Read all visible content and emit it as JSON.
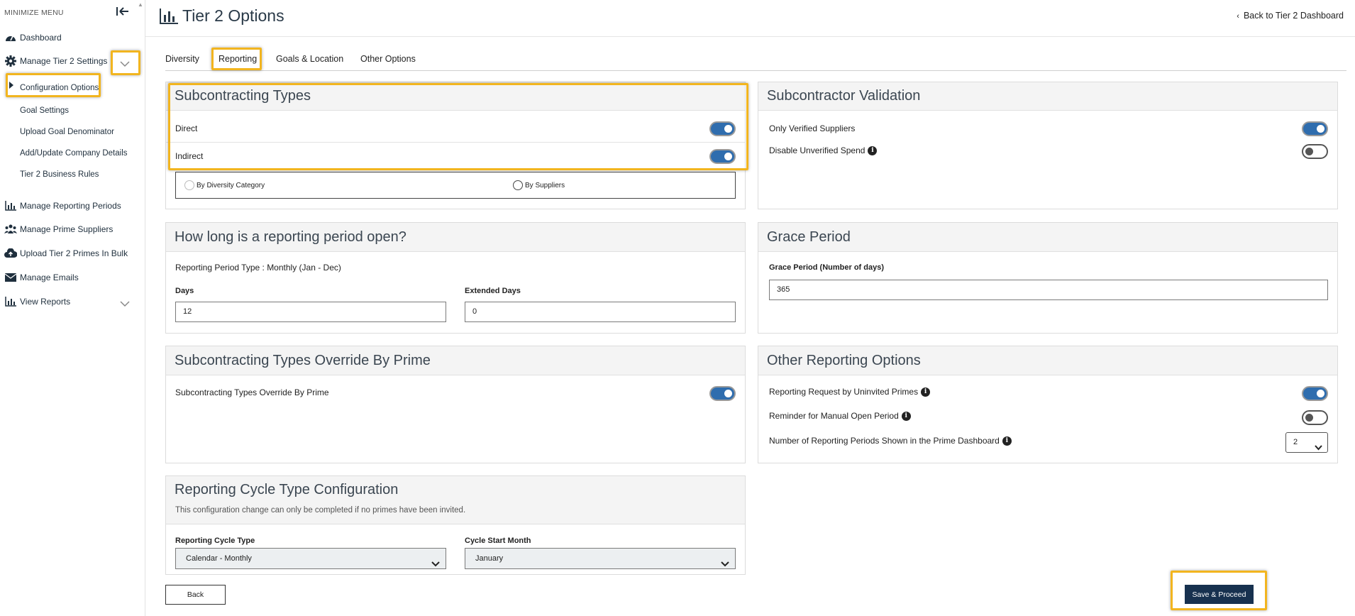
{
  "sidebar": {
    "minimize_label": "MINIMIZE MENU",
    "items": [
      {
        "label": "Dashboard",
        "icon": "dashboard-gauge-icon"
      },
      {
        "label": "Manage Tier 2 Settings",
        "icon": "gear-icon"
      },
      {
        "label": "Manage Reporting Periods",
        "icon": "bar-chart-icon"
      },
      {
        "label": "Manage Prime Suppliers",
        "icon": "users-group-icon"
      },
      {
        "label": "Upload Tier 2 Primes In Bulk",
        "icon": "cloud-upload-icon"
      },
      {
        "label": "Manage Emails",
        "icon": "envelope-icon"
      },
      {
        "label": "View Reports",
        "icon": "bar-chart-icon"
      }
    ],
    "subitems": [
      {
        "label": "Configuration Options"
      },
      {
        "label": "Goal Settings"
      },
      {
        "label": "Upload Goal Denominator"
      },
      {
        "label": "Add/Update Company Details"
      },
      {
        "label": "Tier 2 Business Rules"
      }
    ]
  },
  "header": {
    "title": "Tier 2 Options",
    "back_link": "Back to Tier 2 Dashboard"
  },
  "tabs": [
    {
      "label": "Diversity"
    },
    {
      "label": "Reporting"
    },
    {
      "label": "Goals & Location"
    },
    {
      "label": "Other Options"
    }
  ],
  "subcontracting_types": {
    "title": "Subcontracting Types",
    "direct_label": "Direct",
    "indirect_label": "Indirect",
    "radio_diversity": "By Diversity Category",
    "radio_suppliers": "By Suppliers"
  },
  "subcontractor_validation": {
    "title": "Subcontractor Validation",
    "verified_label": "Only Verified Suppliers",
    "unverified_label": "Disable Unverified Spend"
  },
  "reporting_open": {
    "title": "How long is a reporting period open?",
    "period_type": "Reporting Period Type : Monthly (Jan - Dec)",
    "days_label": "Days",
    "days_value": "12",
    "extended_label": "Extended Days",
    "extended_value": "0"
  },
  "grace_period": {
    "title": "Grace Period",
    "label": "Grace Period (Number of days)",
    "value": "365"
  },
  "override": {
    "title": "Subcontracting Types Override By Prime",
    "label": "Subcontracting Types Override By Prime"
  },
  "other_reporting": {
    "title": "Other Reporting Options",
    "uninvited_label": "Reporting Request by Uninvited Primes",
    "reminder_label": "Reminder for Manual Open Period",
    "periods_label": "Number of Reporting Periods Shown in the Prime Dashboard",
    "periods_value": "2"
  },
  "cycle": {
    "title": "Reporting Cycle Type Configuration",
    "note": "This configuration change can only be completed if no primes have been invited.",
    "type_label": "Reporting Cycle Type",
    "type_value": "Calendar - Monthly",
    "start_label": "Cycle Start Month",
    "start_value": "January"
  },
  "buttons": {
    "back": "Back",
    "save": "Save & Proceed"
  },
  "colors": {
    "highlight": "#f2b51f",
    "toggle_on": "#2f6dae",
    "primary_button": "#17314f"
  }
}
